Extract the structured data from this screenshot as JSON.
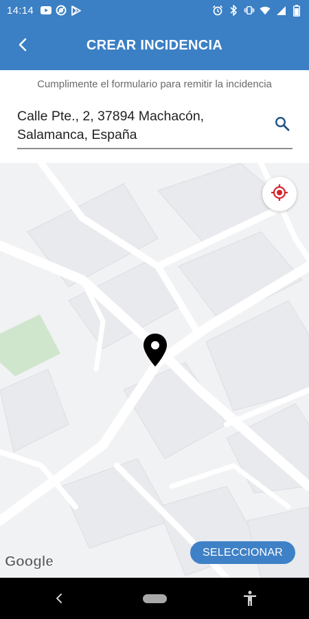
{
  "status_bar": {
    "time": "14:14",
    "left_icons": [
      "youtube-icon",
      "at-icon",
      "play-store-icon"
    ],
    "right_icons": [
      "alarm-icon",
      "bluetooth-icon",
      "vibrate-icon",
      "wifi-icon",
      "signal-icon",
      "battery-icon"
    ]
  },
  "app_bar": {
    "title": "CREAR INCIDENCIA",
    "back_icon": "chevron-left-icon",
    "color": "#3b7fc4"
  },
  "form": {
    "subtitle": "Cumplimente el formulario para remitir la incidencia",
    "address": "Calle Pte., 2, 37894 Machacón, Salamanca, España",
    "search_icon": "search-icon"
  },
  "map": {
    "locate_icon": "crosshair-icon",
    "pin_icon": "location-pin-icon",
    "select_label": "SELECCIONAR",
    "provider": "Google",
    "accent": "#3f81c6"
  },
  "nav_bar": {
    "icons": [
      "back-triangle-icon",
      "home-pill-icon",
      "accessibility-icon"
    ]
  }
}
